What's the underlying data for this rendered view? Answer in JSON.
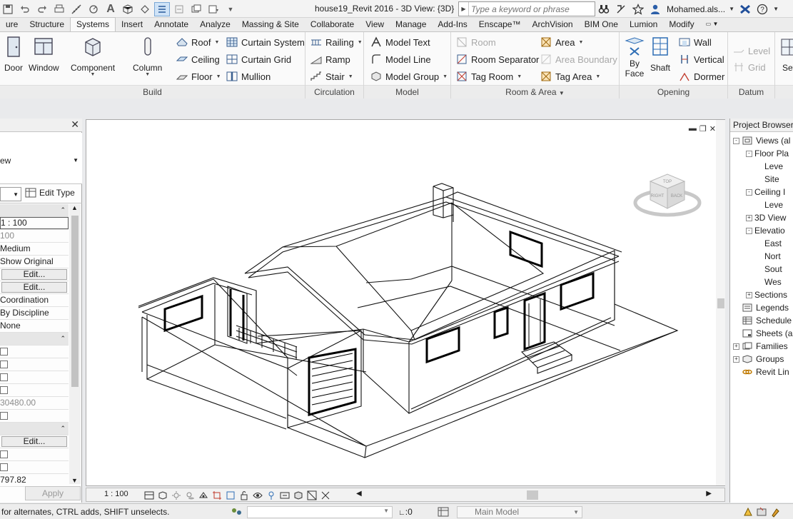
{
  "window": {
    "title": "house19_Revit 2016 - 3D View: {3D}",
    "user_name": "Mohamed.als..."
  },
  "search": {
    "placeholder": "Type a keyword or phrase"
  },
  "tabs": [
    "ure",
    "Structure",
    "Systems",
    "Insert",
    "Annotate",
    "Analyze",
    "Massing & Site",
    "Collaborate",
    "View",
    "Manage",
    "Add-Ins",
    "Enscape™",
    "ArchVision",
    "BIM One",
    "Lumion",
    "Modify"
  ],
  "active_tab": "Systems",
  "ribbon": {
    "build": {
      "title": "Build",
      "door": "Door",
      "window": "Window",
      "component": "Component",
      "column": "Column",
      "roof": "Roof",
      "ceiling": "Ceiling",
      "floor": "Floor",
      "curtain_system": "Curtain System",
      "curtain_grid": "Curtain Grid",
      "mullion": "Mullion"
    },
    "circulation": {
      "title": "Circulation",
      "railing": "Railing",
      "ramp": "Ramp",
      "stair": "Stair"
    },
    "model": {
      "title": "Model",
      "model_text": "Model Text",
      "model_line": "Model Line",
      "model_group": "Model Group"
    },
    "room_area": {
      "title": "Room & Area",
      "room": "Room",
      "room_separator": "Room Separator",
      "tag_room": "Tag Room",
      "area": "Area",
      "area_boundary": "Area Boundary",
      "tag_area": "Tag Area"
    },
    "opening": {
      "title": "Opening",
      "by_face_1": "By",
      "by_face_2": "Face",
      "shaft": "Shaft",
      "wall": "Wall",
      "vertical": "Vertical",
      "dormer": "Dormer"
    },
    "datum": {
      "title": "Datum",
      "level": "Level",
      "grid": "Grid"
    },
    "set": "Set"
  },
  "properties": {
    "type_label": "ew",
    "edit_type": "Edit Type",
    "rows": [
      {
        "kind": "group",
        "text": ""
      },
      {
        "kind": "input",
        "text": "1 : 100"
      },
      {
        "kind": "grey",
        "text": "100"
      },
      {
        "kind": "text",
        "text": "Medium"
      },
      {
        "kind": "text",
        "text": "Show Original"
      },
      {
        "kind": "btn",
        "text": "Edit..."
      },
      {
        "kind": "btn",
        "text": "Edit..."
      },
      {
        "kind": "text",
        "text": "Coordination"
      },
      {
        "kind": "text",
        "text": "By Discipline"
      },
      {
        "kind": "text",
        "text": "None"
      },
      {
        "kind": "group",
        "text": ""
      },
      {
        "kind": "check",
        "text": ""
      },
      {
        "kind": "check",
        "text": ""
      },
      {
        "kind": "check",
        "text": ""
      },
      {
        "kind": "check",
        "text": ""
      },
      {
        "kind": "grey",
        "text": "30480.00"
      },
      {
        "kind": "check",
        "text": ""
      },
      {
        "kind": "group",
        "text": ""
      },
      {
        "kind": "btn",
        "text": "Edit..."
      },
      {
        "kind": "check",
        "text": ""
      },
      {
        "kind": "check",
        "text": ""
      },
      {
        "kind": "text",
        "text": "797.82"
      }
    ],
    "apply": "Apply"
  },
  "view_bar": {
    "scale": "1 : 100"
  },
  "browser": {
    "title": "Project Browser - ",
    "items": [
      {
        "label": "Views (al",
        "level": 0,
        "box": "-",
        "icon": "views-icon"
      },
      {
        "label": "Floor Pla",
        "level": 1,
        "box": "-",
        "icon": ""
      },
      {
        "label": "Leve",
        "level": 2,
        "box": "",
        "icon": ""
      },
      {
        "label": "Site",
        "level": 2,
        "box": "",
        "icon": ""
      },
      {
        "label": "Ceiling I",
        "level": 1,
        "box": "-",
        "icon": ""
      },
      {
        "label": "Leve",
        "level": 2,
        "box": "",
        "icon": ""
      },
      {
        "label": "3D View",
        "level": 1,
        "box": "+",
        "icon": ""
      },
      {
        "label": "Elevatio",
        "level": 1,
        "box": "-",
        "icon": ""
      },
      {
        "label": "East",
        "level": 2,
        "box": "",
        "icon": ""
      },
      {
        "label": "Nort",
        "level": 2,
        "box": "",
        "icon": ""
      },
      {
        "label": "Sout",
        "level": 2,
        "box": "",
        "icon": ""
      },
      {
        "label": "Wes",
        "level": 2,
        "box": "",
        "icon": ""
      },
      {
        "label": "Sections",
        "level": 1,
        "box": "+",
        "icon": ""
      },
      {
        "label": "Legends",
        "level": 0,
        "box": "",
        "icon": "legends-icon"
      },
      {
        "label": "Schedule",
        "level": 0,
        "box": "",
        "icon": "schedules-icon"
      },
      {
        "label": "Sheets (a",
        "level": 0,
        "box": "",
        "icon": "sheets-icon"
      },
      {
        "label": "Families",
        "level": 0,
        "box": "+",
        "icon": "families-icon"
      },
      {
        "label": "Groups",
        "level": 0,
        "box": "+",
        "icon": "groups-icon"
      },
      {
        "label": "Revit Lin",
        "level": 0,
        "box": "",
        "icon": "revit-links-icon"
      }
    ]
  },
  "status": {
    "message": "for alternates, CTRL adds, SHIFT unselects.",
    "selection_count": ":0",
    "model": "Main Model"
  },
  "viewcube": {
    "top": "TOP",
    "right": "RIGHT",
    "back": "BACK"
  }
}
